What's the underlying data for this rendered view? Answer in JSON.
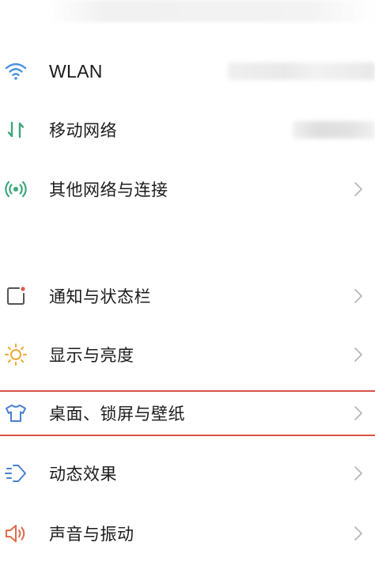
{
  "settings": {
    "items": [
      {
        "label": "WLAN",
        "icon": "wifi-icon",
        "value": "",
        "icon_color": "#4a8fe0"
      },
      {
        "label": "移动网络",
        "icon": "mobile-data-icon",
        "value": "",
        "icon_color": "#3aa87a"
      },
      {
        "label": "其他网络与连接",
        "icon": "connection-icon",
        "value": "",
        "icon_color": "#3aa87a"
      },
      {
        "label": "通知与状态栏",
        "icon": "notification-icon",
        "value": "",
        "icon_color": "#555555"
      },
      {
        "label": "显示与亮度",
        "icon": "brightness-icon",
        "value": "",
        "icon_color": "#f0a830"
      },
      {
        "label": "桌面、锁屏与壁纸",
        "icon": "shirt-icon",
        "value": "",
        "icon_color": "#4a7fd0"
      },
      {
        "label": "动态效果",
        "icon": "animation-icon",
        "value": "",
        "icon_color": "#4a7fd0"
      },
      {
        "label": "声音与振动",
        "icon": "speaker-icon",
        "value": "",
        "icon_color": "#e06a4a"
      }
    ]
  },
  "highlight_color": "#d9534a",
  "chevron_color": "#b8b8b8"
}
